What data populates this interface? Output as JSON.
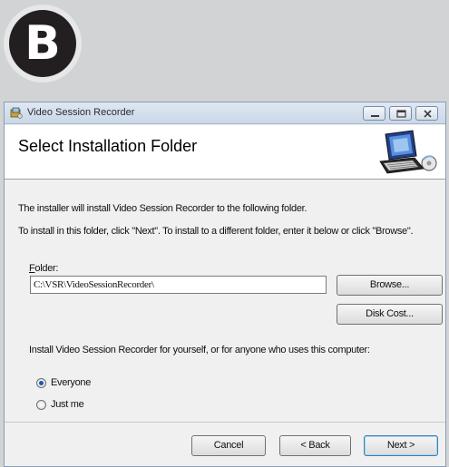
{
  "badge": {
    "letter": "B"
  },
  "window": {
    "title": "Video Session Recorder",
    "controls": {
      "minimize": "minimize-icon",
      "maximize": "maximize-icon",
      "close": "close-icon"
    }
  },
  "header": {
    "title": "Select Installation Folder",
    "icon": "computer-install-icon"
  },
  "body": {
    "intro": "The installer will install Video Session Recorder to the following folder.",
    "instruction": "To install in this folder, click \"Next\". To install to a different folder, enter it below or click \"Browse\".",
    "folder_label_accel": "F",
    "folder_label_rest": "older:",
    "folder_value": "C:\\VSR\\VideoSessionRecorder\\",
    "browse_label": "Browse...",
    "disk_cost_label": "Disk Cost...",
    "install_for_question": "Install Video Session Recorder for yourself, or for anyone who uses this computer:",
    "options": [
      {
        "label": "Everyone",
        "selected": true
      },
      {
        "label": "Just me",
        "selected": false
      }
    ]
  },
  "footer": {
    "cancel_label": "Cancel",
    "back_label": "< Back",
    "next_label": "Next >"
  },
  "colors": {
    "background": "#d2d3d5",
    "badge": "#231f20",
    "radio_dot": "#1a58b5"
  }
}
